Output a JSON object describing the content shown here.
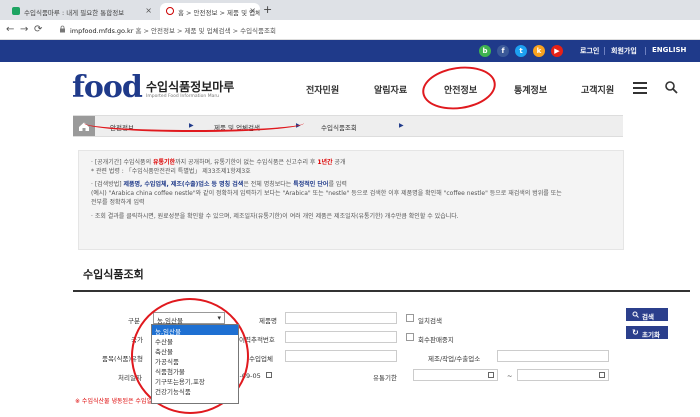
{
  "browser": {
    "tabs": [
      {
        "label": "수입식품마루 : 내게 필요한 통합정보"
      },
      {
        "label": "홈 > 안전정보 > 제품 및 업체조"
      }
    ],
    "url_host": "impfood.mfds.go.kr",
    "url_path": " 홈 > 안전정보 > 제품 및 업체검색 > 수입식품조회"
  },
  "utility": {
    "login": "로그인",
    "join": "회원가입",
    "english": "ENGLISH",
    "sns": [
      "sns-blog",
      "facebook",
      "twitter",
      "kakao",
      "youtube"
    ]
  },
  "header": {
    "logo_word": "food",
    "title": "수입식품정보마루",
    "subtitle": "Imported Food Information Maru",
    "nav": [
      "전자민원",
      "알림자료",
      "안전정보",
      "통계정보",
      "고객지원"
    ]
  },
  "breadcrumb": [
    "안전정보",
    "제품 및 업체검색",
    "수입식품조회"
  ],
  "info": {
    "l1a": "· [공개기간] 수입식품의 ",
    "l1b": "유통기한",
    "l1c": "까지 공개하며, 유통기한이 없는 수입식품은 신고수리 후 ",
    "l1d": "1년간",
    "l1e": " 공개",
    "l2": "* 관련 법령 : 「수입식품안전관리 특별법」 제33조제1항제3호",
    "l3a": "· [검색방법] ",
    "l3b": "제품명, 수입업체, 제조(수출)업소 등 명칭 검색",
    "l3c": "은 전체 명칭보다는 ",
    "l3d": "특정적인 단어",
    "l3e": "를 입력",
    "l4": "(예시) \"Arabica china coffee nestle\"와 같이 정확하게 입력하기 보다는 \"Arabica\" 또는 \"nestle\" 등으로 검색한 이후 제품명을 확인해 \"coffee nestle\" 등으로 재검색의 범위를 또는",
    "l5": "전부를 정확하게 입력",
    "l6": "· 조회 결과를 클릭하시면, 원료성분을 확인할 수 있으며, 제조일자(유통기한)이 여러 개인 제품은 제조일자(유통기한) 개수만큼 확인할 수 있습니다."
  },
  "section_title": "수입식품조회",
  "form": {
    "label_category": "구분",
    "selected_category": "농,임산물",
    "options": [
      "농,임산물",
      "수산물",
      "축산물",
      "가공식품",
      "식품첨가물",
      "기구또는용기,포장",
      "건강기능식품"
    ],
    "label_product": "제품명",
    "label_exact": "일치검색",
    "label_country": "국가",
    "label_recall": "회수판매중지",
    "label_origin_no": "이력추적번호",
    "label_type": "품목(식품)유형",
    "label_importer": "수입업체",
    "label_maker": "제조/작업/수출업소",
    "label_period": "처리일자",
    "date_from": "2022-09-05",
    "label_expiry": "유통기한",
    "tilde": "~",
    "search_btn": "검색",
    "reset_btn": "초기화"
  },
  "note": "※ 수입식산물 냉동된은 수입일자를 정확하게 확인할 수 없습니다."
}
